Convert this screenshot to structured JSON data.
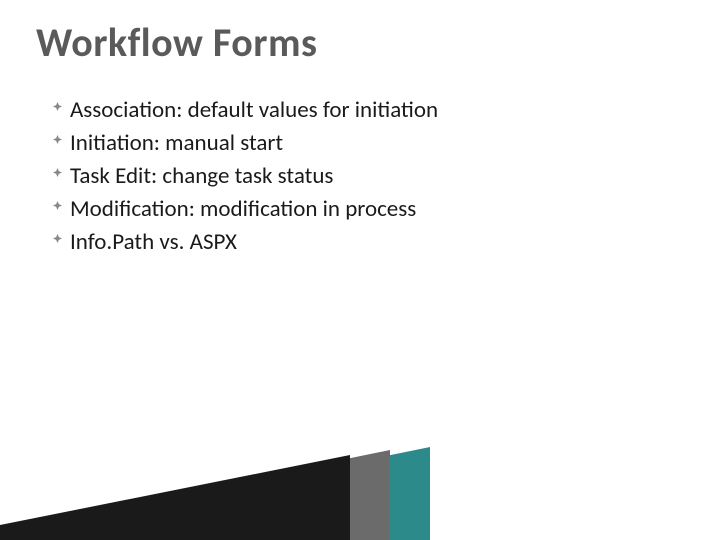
{
  "title": "Workflow Forms",
  "bullets": [
    "Association: default values for initiation",
    "Initiation: manual start",
    "Task Edit: change task status",
    "Modification: modification in process",
    "Info.Path vs. ASPX"
  ],
  "colors": {
    "title": "#5a5a5a",
    "text": "#1a1a1a",
    "bullet": "#888888",
    "accent_dark": "#1a1a1a",
    "accent_gray": "#6b6b6b",
    "accent_teal": "#2d8a8a"
  }
}
